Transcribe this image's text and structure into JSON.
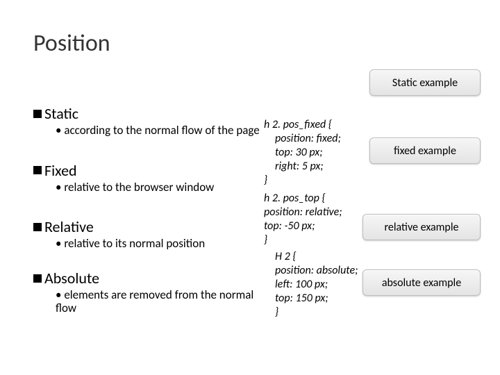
{
  "title": "Position",
  "sections": [
    {
      "heading": "Static",
      "bullet": "according to the normal flow of the page"
    },
    {
      "heading": "Fixed",
      "bullet": "relative to the browser window"
    },
    {
      "heading": "Relative",
      "bullet": "relative to its normal position"
    },
    {
      "heading": "Absolute",
      "bullet": "elements are removed from the normal flow"
    }
  ],
  "code": {
    "fixed": {
      "sel": "h 2. pos_fixed {",
      "l1": "position: fixed;",
      "l2": "top: 30 px;",
      "l3": "right: 5 px;",
      "close": "}"
    },
    "rel": {
      "sel": "h 2. pos_top {",
      "l1": "position: relative;",
      "l2": "top: -50 px;",
      "close": "}"
    },
    "abs": {
      "sel": "H 2 {",
      "l1": "position: absolute;",
      "l2": "left: 100 px;",
      "l3": "top: 150 px;",
      "close": "}"
    }
  },
  "buttons": {
    "static": "Static example",
    "fixed": "fixed example",
    "relative": "relative example",
    "absolute": "absolute example"
  }
}
